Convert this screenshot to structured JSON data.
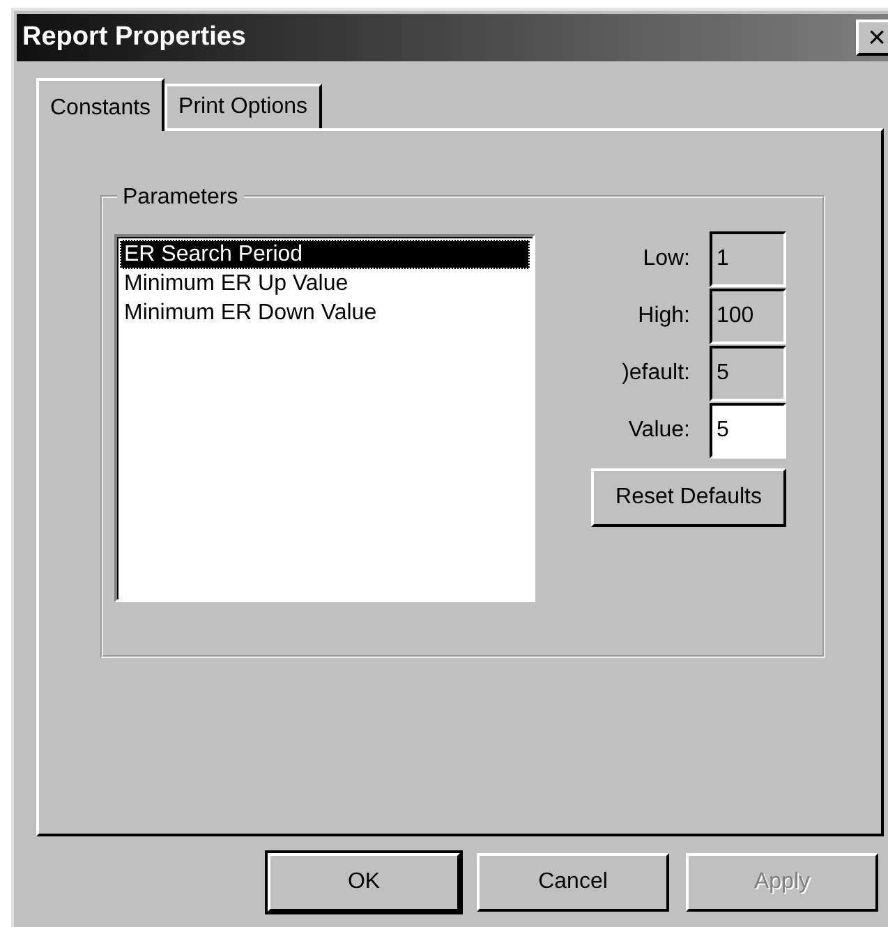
{
  "window": {
    "title": "Report Properties",
    "close": "×"
  },
  "tabs": [
    {
      "label": "Constants",
      "selected": true
    },
    {
      "label": "Print Options",
      "selected": false
    }
  ],
  "group": {
    "title": "Parameters"
  },
  "list": [
    {
      "label": "ER Search Period",
      "selected": true
    },
    {
      "label": "Minimum ER Up Value",
      "selected": false
    },
    {
      "label": "Minimum ER Down Value",
      "selected": false
    }
  ],
  "fields": [
    {
      "label": "Low:",
      "value": "1",
      "disabled": true
    },
    {
      "label": "High:",
      "value": "100",
      "disabled": true
    },
    {
      "label": ")efault:",
      "value": "5",
      "disabled": true
    },
    {
      "label": "Value:",
      "value": "5",
      "disabled": false
    }
  ],
  "reset_button": "Reset Defaults",
  "buttons": [
    {
      "label": "OK",
      "default": true,
      "disabled": false
    },
    {
      "label": "Cancel",
      "default": false,
      "disabled": false
    },
    {
      "label": "Apply",
      "default": false,
      "disabled": true
    }
  ]
}
